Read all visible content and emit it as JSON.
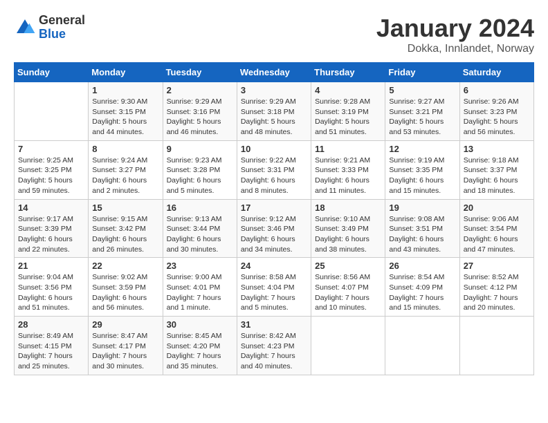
{
  "header": {
    "logo_general": "General",
    "logo_blue": "Blue",
    "month_title": "January 2024",
    "location": "Dokka, Innlandet, Norway"
  },
  "days_of_week": [
    "Sunday",
    "Monday",
    "Tuesday",
    "Wednesday",
    "Thursday",
    "Friday",
    "Saturday"
  ],
  "weeks": [
    [
      {
        "day": "",
        "info": ""
      },
      {
        "day": "1",
        "info": "Sunrise: 9:30 AM\nSunset: 3:15 PM\nDaylight: 5 hours\nand 44 minutes."
      },
      {
        "day": "2",
        "info": "Sunrise: 9:29 AM\nSunset: 3:16 PM\nDaylight: 5 hours\nand 46 minutes."
      },
      {
        "day": "3",
        "info": "Sunrise: 9:29 AM\nSunset: 3:18 PM\nDaylight: 5 hours\nand 48 minutes."
      },
      {
        "day": "4",
        "info": "Sunrise: 9:28 AM\nSunset: 3:19 PM\nDaylight: 5 hours\nand 51 minutes."
      },
      {
        "day": "5",
        "info": "Sunrise: 9:27 AM\nSunset: 3:21 PM\nDaylight: 5 hours\nand 53 minutes."
      },
      {
        "day": "6",
        "info": "Sunrise: 9:26 AM\nSunset: 3:23 PM\nDaylight: 5 hours\nand 56 minutes."
      }
    ],
    [
      {
        "day": "7",
        "info": "Sunrise: 9:25 AM\nSunset: 3:25 PM\nDaylight: 5 hours\nand 59 minutes."
      },
      {
        "day": "8",
        "info": "Sunrise: 9:24 AM\nSunset: 3:27 PM\nDaylight: 6 hours\nand 2 minutes."
      },
      {
        "day": "9",
        "info": "Sunrise: 9:23 AM\nSunset: 3:28 PM\nDaylight: 6 hours\nand 5 minutes."
      },
      {
        "day": "10",
        "info": "Sunrise: 9:22 AM\nSunset: 3:31 PM\nDaylight: 6 hours\nand 8 minutes."
      },
      {
        "day": "11",
        "info": "Sunrise: 9:21 AM\nSunset: 3:33 PM\nDaylight: 6 hours\nand 11 minutes."
      },
      {
        "day": "12",
        "info": "Sunrise: 9:19 AM\nSunset: 3:35 PM\nDaylight: 6 hours\nand 15 minutes."
      },
      {
        "day": "13",
        "info": "Sunrise: 9:18 AM\nSunset: 3:37 PM\nDaylight: 6 hours\nand 18 minutes."
      }
    ],
    [
      {
        "day": "14",
        "info": "Sunrise: 9:17 AM\nSunset: 3:39 PM\nDaylight: 6 hours\nand 22 minutes."
      },
      {
        "day": "15",
        "info": "Sunrise: 9:15 AM\nSunset: 3:42 PM\nDaylight: 6 hours\nand 26 minutes."
      },
      {
        "day": "16",
        "info": "Sunrise: 9:13 AM\nSunset: 3:44 PM\nDaylight: 6 hours\nand 30 minutes."
      },
      {
        "day": "17",
        "info": "Sunrise: 9:12 AM\nSunset: 3:46 PM\nDaylight: 6 hours\nand 34 minutes."
      },
      {
        "day": "18",
        "info": "Sunrise: 9:10 AM\nSunset: 3:49 PM\nDaylight: 6 hours\nand 38 minutes."
      },
      {
        "day": "19",
        "info": "Sunrise: 9:08 AM\nSunset: 3:51 PM\nDaylight: 6 hours\nand 43 minutes."
      },
      {
        "day": "20",
        "info": "Sunrise: 9:06 AM\nSunset: 3:54 PM\nDaylight: 6 hours\nand 47 minutes."
      }
    ],
    [
      {
        "day": "21",
        "info": "Sunrise: 9:04 AM\nSunset: 3:56 PM\nDaylight: 6 hours\nand 51 minutes."
      },
      {
        "day": "22",
        "info": "Sunrise: 9:02 AM\nSunset: 3:59 PM\nDaylight: 6 hours\nand 56 minutes."
      },
      {
        "day": "23",
        "info": "Sunrise: 9:00 AM\nSunset: 4:01 PM\nDaylight: 7 hours\nand 1 minute."
      },
      {
        "day": "24",
        "info": "Sunrise: 8:58 AM\nSunset: 4:04 PM\nDaylight: 7 hours\nand 5 minutes."
      },
      {
        "day": "25",
        "info": "Sunrise: 8:56 AM\nSunset: 4:07 PM\nDaylight: 7 hours\nand 10 minutes."
      },
      {
        "day": "26",
        "info": "Sunrise: 8:54 AM\nSunset: 4:09 PM\nDaylight: 7 hours\nand 15 minutes."
      },
      {
        "day": "27",
        "info": "Sunrise: 8:52 AM\nSunset: 4:12 PM\nDaylight: 7 hours\nand 20 minutes."
      }
    ],
    [
      {
        "day": "28",
        "info": "Sunrise: 8:49 AM\nSunset: 4:15 PM\nDaylight: 7 hours\nand 25 minutes."
      },
      {
        "day": "29",
        "info": "Sunrise: 8:47 AM\nSunset: 4:17 PM\nDaylight: 7 hours\nand 30 minutes."
      },
      {
        "day": "30",
        "info": "Sunrise: 8:45 AM\nSunset: 4:20 PM\nDaylight: 7 hours\nand 35 minutes."
      },
      {
        "day": "31",
        "info": "Sunrise: 8:42 AM\nSunset: 4:23 PM\nDaylight: 7 hours\nand 40 minutes."
      },
      {
        "day": "",
        "info": ""
      },
      {
        "day": "",
        "info": ""
      },
      {
        "day": "",
        "info": ""
      }
    ]
  ]
}
